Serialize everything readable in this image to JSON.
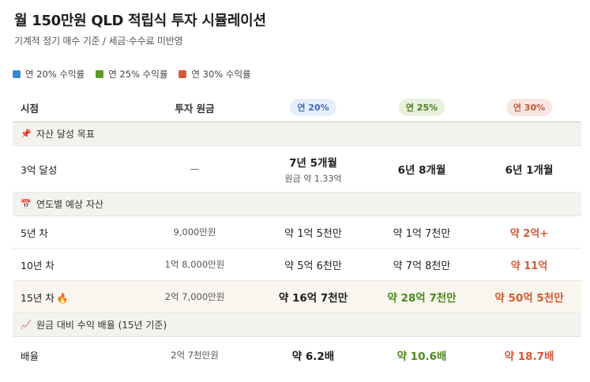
{
  "title": "월 150만원 QLD 적립식 투자 시뮬레이션",
  "subtitle": "기계적 정기 매수 기준 / 세금·수수료 미반영",
  "legend": [
    {
      "label": "연 20% 수익률",
      "color": "#3b87d8"
    },
    {
      "label": "연 25% 수익률",
      "color": "#5c9a2b"
    },
    {
      "label": "연 30% 수익률",
      "color": "#d6583a"
    }
  ],
  "header": {
    "col0": "시점",
    "col1": "투자 원금",
    "col2": "연 20%",
    "col3": "연 25%",
    "col4": "연 30%"
  },
  "sections": {
    "goal": {
      "icon": "📌",
      "title": "자산 달성 목표"
    },
    "yearly": {
      "icon": "📅",
      "title": "연도별 예상 자산"
    },
    "ratio": {
      "icon": "📈",
      "title": "원금 대비 수익 배율 (15년 기준)"
    }
  },
  "rows": {
    "goal_3": {
      "label": "3억 달성",
      "principal": "—",
      "r20": "7년 5개월",
      "r20_sub": "원금 약 1.33억",
      "r25": "6년 8개월",
      "r30": "6년 1개월"
    },
    "y5": {
      "label": "5년 차",
      "principal": "9,000만원",
      "r20": "약 1억 5천만",
      "r25": "약 1억 7천만",
      "r30": "약 2억+"
    },
    "y10": {
      "label": "10년 차",
      "principal": "1억 8,000만원",
      "r20": "약 5억 6천만",
      "r25": "약 7억 8천만",
      "r30": "약 11억"
    },
    "y15": {
      "label": "15년 차",
      "fire": "🔥",
      "principal": "2억 7,000만원",
      "r20": "약 16억 7천만",
      "r25": "약 28억 7천만",
      "r30": "약 50억 5천만"
    },
    "mult": {
      "label": "배율",
      "principal": "2억 7천만원",
      "r20": "약 6.2배",
      "r25": "약 10.6배",
      "r30": "약 18.7배"
    }
  }
}
